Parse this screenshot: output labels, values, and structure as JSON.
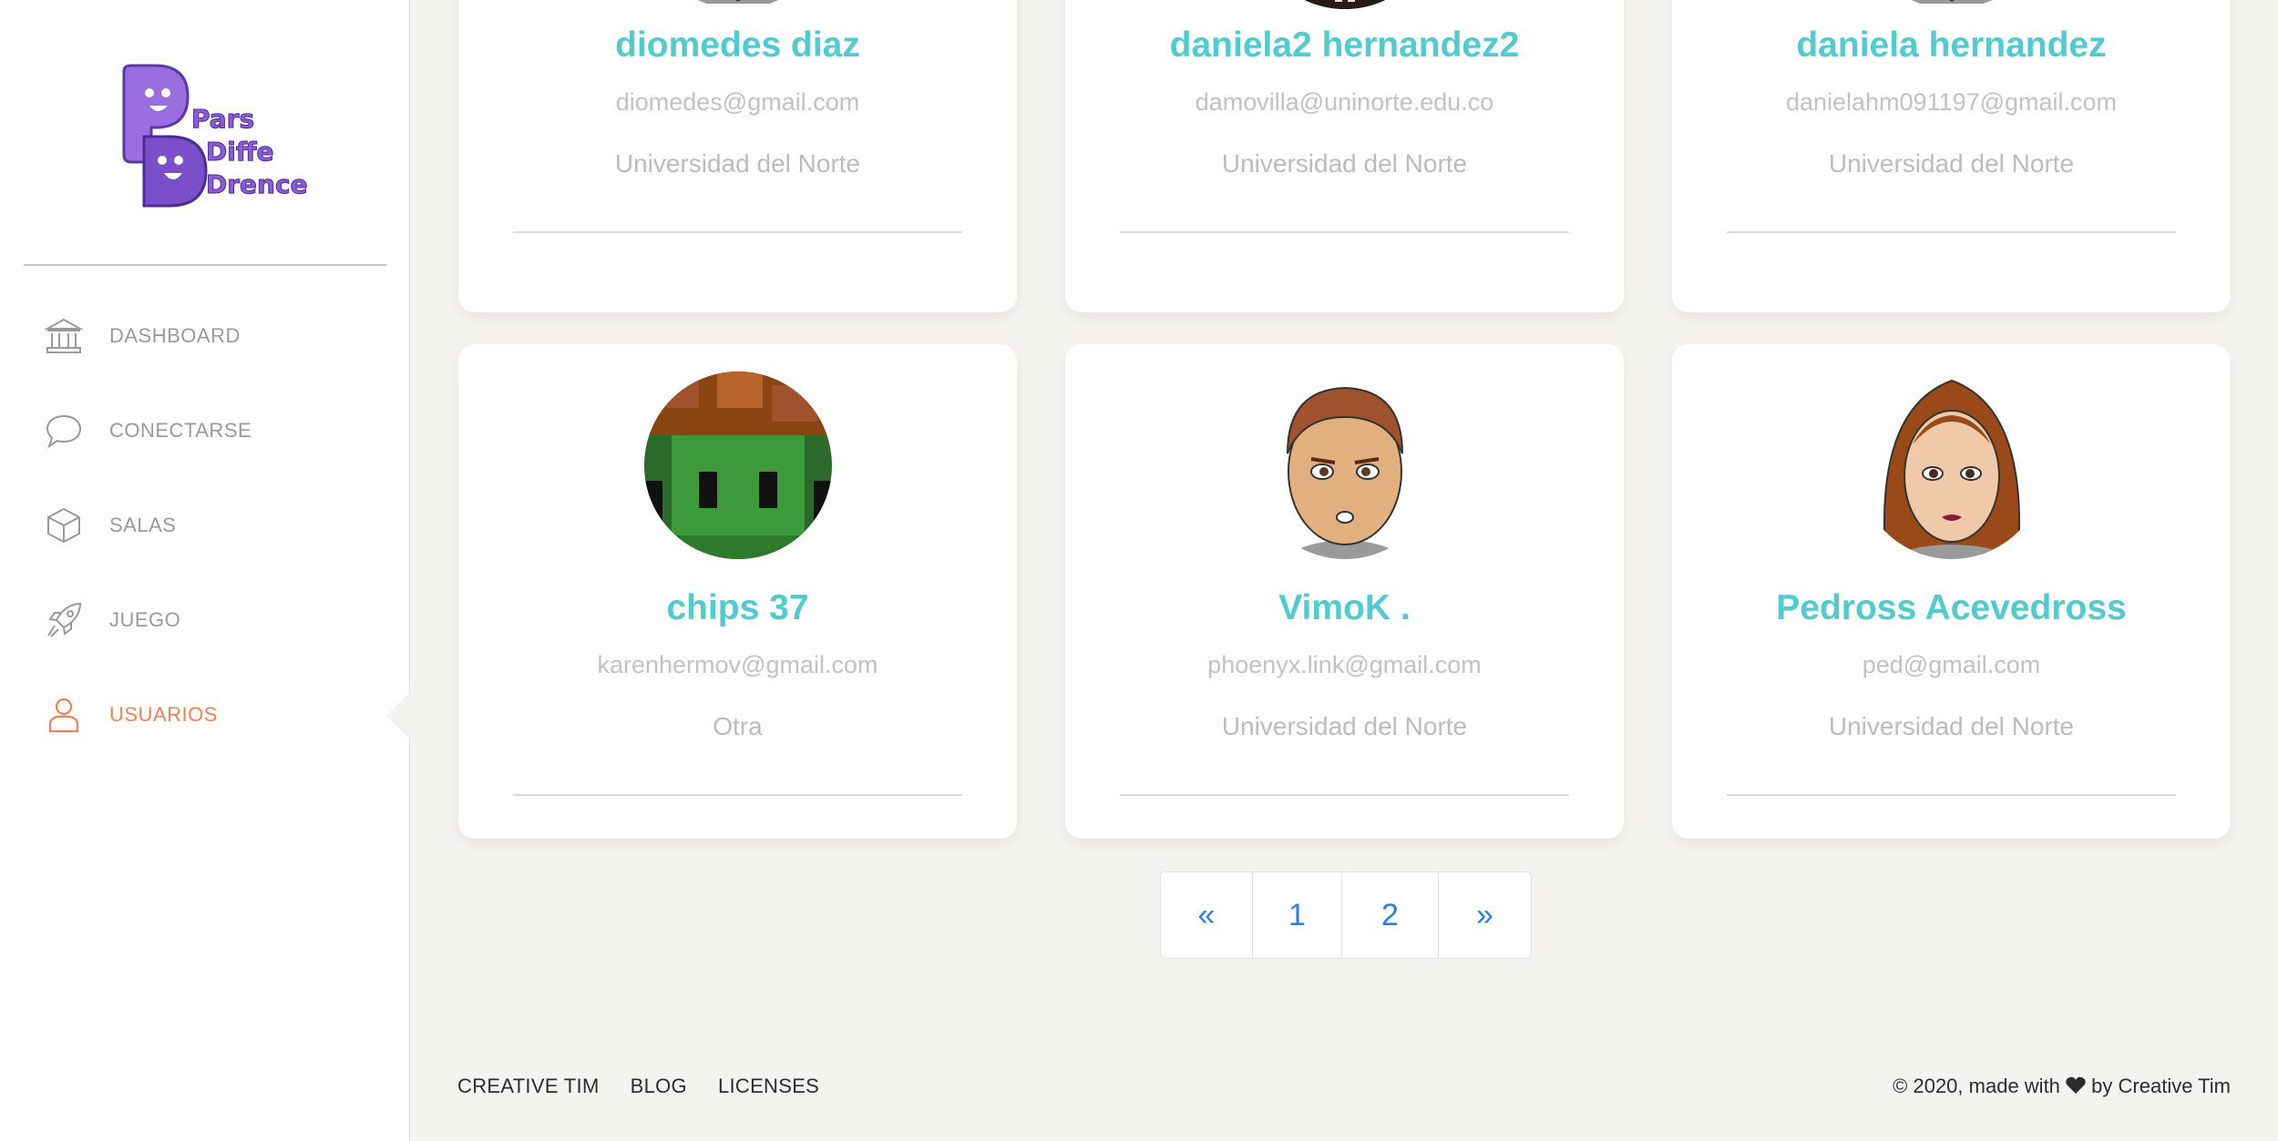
{
  "brand": {
    "logo_lines": [
      "Pars",
      "Diffe",
      "Drence"
    ]
  },
  "sidebar": {
    "items": [
      {
        "label": "DASHBOARD",
        "icon": "bank-icon",
        "active": false
      },
      {
        "label": "CONECTARSE",
        "icon": "chat-bubble-icon",
        "active": false
      },
      {
        "label": "SALAS",
        "icon": "cube-icon",
        "active": false
      },
      {
        "label": "JUEGO",
        "icon": "rocket-icon",
        "active": false
      },
      {
        "label": "USUARIOS",
        "icon": "user-icon",
        "active": true
      }
    ]
  },
  "users": [
    {
      "name": "diomedes diaz",
      "email": "diomedes@gmail.com",
      "org": "Universidad del Norte",
      "avatar": "cartoon-man-avatar"
    },
    {
      "name": "daniela2 hernandez2",
      "email": "damovilla@uninorte.edu.co",
      "org": "Universidad del Norte",
      "avatar": "dark-hair-avatar"
    },
    {
      "name": "daniela hernandez",
      "email": "danielahm091197@gmail.com",
      "org": "Universidad del Norte",
      "avatar": "cartoon-man-avatar"
    },
    {
      "name": "chips 37",
      "email": "karenhermov@gmail.com",
      "org": "Otra",
      "avatar": "pixel-goblin-avatar"
    },
    {
      "name": "VimoK .",
      "email": "phoenyx.link@gmail.com",
      "org": "Universidad del Norte",
      "avatar": "cartoon-man-avatar"
    },
    {
      "name": "Pedross Acevedross",
      "email": "ped@gmail.com",
      "org": "Universidad del Norte",
      "avatar": "cartoon-woman-avatar"
    }
  ],
  "pagination": {
    "prev": "«",
    "pages": [
      "1",
      "2"
    ],
    "next": "»"
  },
  "footer": {
    "links": [
      "CREATIVE TIM",
      "BLOG",
      "LICENSES"
    ],
    "copyright_prefix": "© 2020, made with",
    "copyright_suffix": "by Creative Tim"
  },
  "colors": {
    "accent": "#51cbce",
    "active": "#ef8157",
    "link": "#2a7fe0",
    "background": "#f4f3ef",
    "logo": "#7a4fc9"
  }
}
